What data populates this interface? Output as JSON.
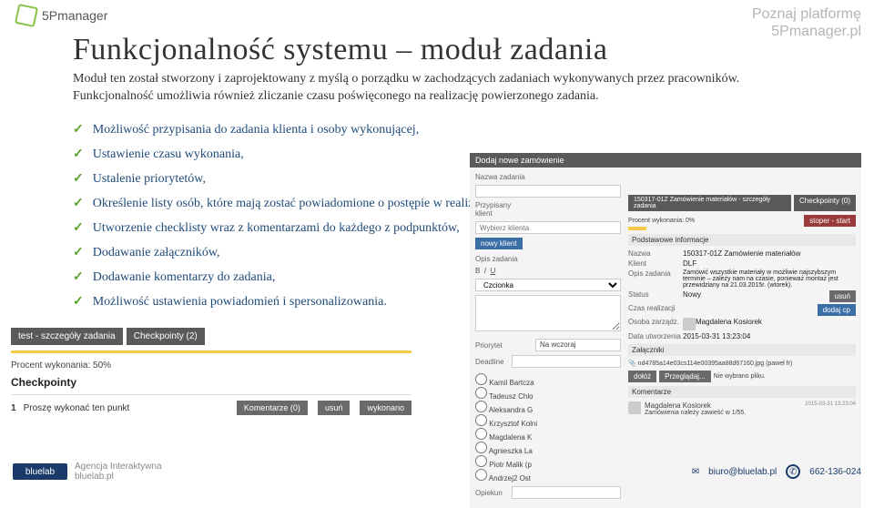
{
  "header_right": {
    "line1": "Poznaj platformę",
    "line2": "5Pmanager.pl"
  },
  "logo_tl": {
    "name": "5Pmanager"
  },
  "title": "Funkcjonalność systemu – moduł zadania",
  "subtitle": "Moduł ten został stworzony i zaprojektowany z myślą o porządku w zachodzących zadaniach wykonywanych przez pracowników. Funkcjonalność umożliwia również zliczanie czasu poświęconego na realizację powierzonego zadania.",
  "bullets": [
    "Możliwość przypisania do zadania klienta i osoby wykonującej,",
    "Ustawienie czasu wykonania,",
    "Ustalenie priorytetów,",
    "Określenie listy osób, które mają zostać powiadomione o postępie w realizac",
    "Utworzenie  checklisty wraz z komentarzami do każdego z podpunktów,",
    "Dodawanie załączników,",
    "Dodawanie komentarzy do zadania,",
    "Możliwość ustawienia powiadomień i spersonalizowania."
  ],
  "left": {
    "tab1": "test - szczegóły zadania",
    "tab2": "Checkpointy (2)",
    "progress_label": "Procent wykonania: 50%",
    "cp_head": "Checkpointy",
    "cp_num": "1",
    "cp_text": "Proszę wykonać ten punkt",
    "btn_comments": "Komentarze (0)",
    "btn_delete": "usuń",
    "btn_done": "wykonano"
  },
  "right": {
    "head": "Dodaj nowe zamówienie",
    "name_label": "Nazwa zadania",
    "client_label": "Przypisany klient",
    "client_placeholder": "Wybierz klienta",
    "new_client_btn": "nowy klient",
    "desc_label": "Opis zadania",
    "priority_label": "Priorytet",
    "priority_val": "Na wczoraj",
    "deadline_label": "Deadline",
    "opiekun_label": "Opiekun",
    "details_tab": "150317-01Z Zamówienie materiałów - szczegóły zadania",
    "cp_tab": "Checkpointy (0)",
    "progress_label": "Procent wykonania: 0%",
    "stoper_btn": "stoper - start",
    "section_basic": "Podstawowe informacje",
    "info": {
      "name_k": "Nazwa",
      "name_v": "150317-01Z Zamówienie materiałów",
      "klient_k": "Klient",
      "klient_v": "DLF",
      "opis_k": "Opis zadania",
      "opis_v": "Zamówić wszystkie materiały w możliwie najszybszym terminie – zależy nam na czasie, ponieważ montaż jest przewidziany na 21.03.2015r. (wtorek).",
      "status_k": "Status",
      "status_v": "Nowy",
      "czas_k": "Czas realizacji",
      "osoba_k": "Osoba zarządz.",
      "osoba_v": "Magdalena Kosiorek",
      "data_k": "Data utworzenia",
      "data_v": "2015-03-31 13:23:04"
    },
    "btn_usun": "usuń",
    "btn_dodaj": "dodaj cp",
    "section_att": "Załączniki",
    "att_file": "nd4785a14e03cs114e00395aa88d67160.jpg (paweł fr)",
    "btn_dolacz": "dołóż",
    "btn_przegladaj": "Przeglądaj...",
    "att_none": "Nie wybrano pliku.",
    "section_kom": "Komentarze",
    "kom_author": "Magdalena Kosiorek",
    "kom_date": "2015-03-31 13:23:04",
    "kom_text": "Zamówienia należy zawieść w 1/55.",
    "people": [
      "Kamil Bartcza",
      "Tadeusz Chlo",
      "Aleksandra G",
      "Krzysztof Kolni",
      "Magdalena K",
      "Agnieszka La",
      "Piotr Malik (p",
      "Andrzej2 Ost"
    ]
  },
  "footer": {
    "agency1": "Agencja Interaktywna",
    "agency2": "bluelab.pl",
    "email": "biuro@bluelab.pl",
    "phone": "662-136-024",
    "logo": "bluelab"
  }
}
